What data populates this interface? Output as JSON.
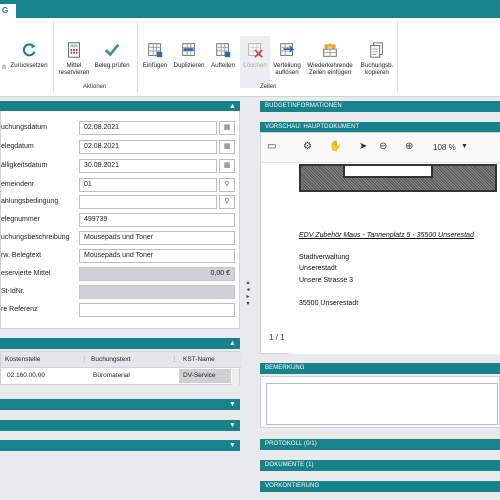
{
  "top_tab": "G",
  "ribbon": {
    "buttons": [
      {
        "label": "n"
      },
      {
        "label": "Zurücksetzen"
      },
      {
        "label": "Mittel\nreservieren"
      },
      {
        "label": "Beleg prüfen"
      },
      {
        "label": "Einfügen"
      },
      {
        "label": "Duplizieren"
      },
      {
        "label": "Aufteilen"
      },
      {
        "label": "Löschen"
      },
      {
        "label": "Verteilung\nauflösen"
      },
      {
        "label": "Wiederkehrende\nZeilen einfügen"
      },
      {
        "label": "Buchungsb.\nkopieren"
      }
    ],
    "groups": {
      "aktionen": "Aktionen",
      "zeilen": "Zeilen"
    }
  },
  "left": {
    "fields": [
      {
        "label": "uchungsdatum",
        "value": "02.08.2021",
        "btn": "cal"
      },
      {
        "label": "elegdatum",
        "value": "02.08.2021",
        "btn": "cal"
      },
      {
        "label": "älligkeitsdatum",
        "value": "30.08.2021",
        "btn": "cal"
      },
      {
        "label": "emeindenr",
        "value": "01",
        "btn": "search"
      },
      {
        "label": "ahlungsbedingung",
        "value": "",
        "btn": "search"
      },
      {
        "label": "elegnummer",
        "value": "499739"
      },
      {
        "label": "uchungsbeschreibung",
        "value": "Mousepads und Toner"
      },
      {
        "label": "rw. Belegtext",
        "value": "Mousepads und Toner"
      },
      {
        "label": "eservierte Mittel",
        "value": "0,00 €",
        "grey": true
      },
      {
        "label": "St-IdNr.",
        "value": "",
        "grey": true
      },
      {
        "label": "re Referenz",
        "value": ""
      }
    ],
    "grid": {
      "columns": [
        "Kostenstelle",
        "Buchungstext",
        "KST-Name"
      ],
      "rows": [
        [
          "02.160.00.00",
          "Büromaterial",
          "DV-Service"
        ]
      ]
    }
  },
  "right": {
    "budget": "BUDGETINFORMATIONEN",
    "preview": "VORSCHAU: HAUPTDOKUMENT",
    "zoom": "108 %",
    "doc": {
      "sender": "EDV Zubehör Maus - Tannenplatz 5 - 35500 Unserestad",
      "lines": [
        "Stadtverwaltung",
        "Unserestadt",
        "Unsere Strasse 3",
        "",
        "35500 Unserestadt"
      ]
    },
    "pager": "1 / 1",
    "bemerkung": "BEMERKUNG",
    "protokoll": "PROTOKOLL   (0/1)",
    "dokumente": "DOKUMENTE   (1)",
    "vorkontierung": "VORKONTIERUNG"
  },
  "colors": {
    "teal": "#17828a",
    "bg": "#e8eaeb"
  }
}
